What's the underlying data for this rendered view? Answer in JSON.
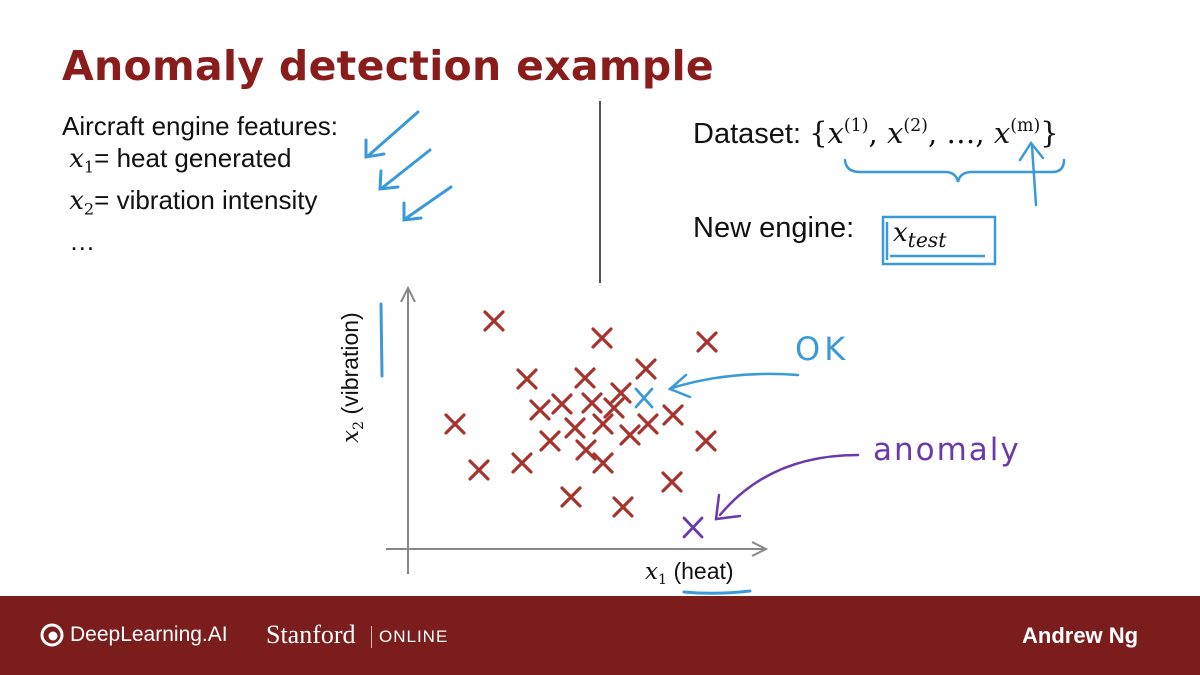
{
  "title": "Anomaly detection example",
  "features": {
    "heading": "Aircraft engine features:",
    "items": [
      {
        "var": "x",
        "sub": "1",
        "text": "= heat generated"
      },
      {
        "var": "x",
        "sub": "2",
        "text": "= vibration intensity"
      }
    ],
    "more": "…"
  },
  "dataset": {
    "label": "Dataset: ",
    "open_brace": "{",
    "x1": "x",
    "x1_sup": "(1)",
    "sep1": ", ",
    "x2": "x",
    "x2_sup": "(2)",
    "sep2": ", …, ",
    "xm": "x",
    "xm_sup": "(m)",
    "close_brace": "}"
  },
  "new_engine": {
    "label": "New engine:",
    "var": "x",
    "sub": "test"
  },
  "plot": {
    "xlabel_var": "x",
    "xlabel_sub": "1",
    "xlabel_text": " (heat)",
    "ylabel_var": "x",
    "ylabel_sub": "2",
    "ylabel_text": " (vibration)"
  },
  "annotations": {
    "ok": "OK",
    "anomaly": "anomaly"
  },
  "colors": {
    "title": "#8a1c1c",
    "data_points": "#a8322e",
    "ok_annotation": "#3a9ad9",
    "anomaly_annotation": "#6b3aa8",
    "footer": "#7b1d1d"
  },
  "footer": {
    "brand1": "DeepLearning.AI",
    "brand1_icon": "deeplearning-logo-icon",
    "brand2": "Stanford",
    "brand2_suffix": "ONLINE",
    "author": "Andrew Ng"
  }
}
